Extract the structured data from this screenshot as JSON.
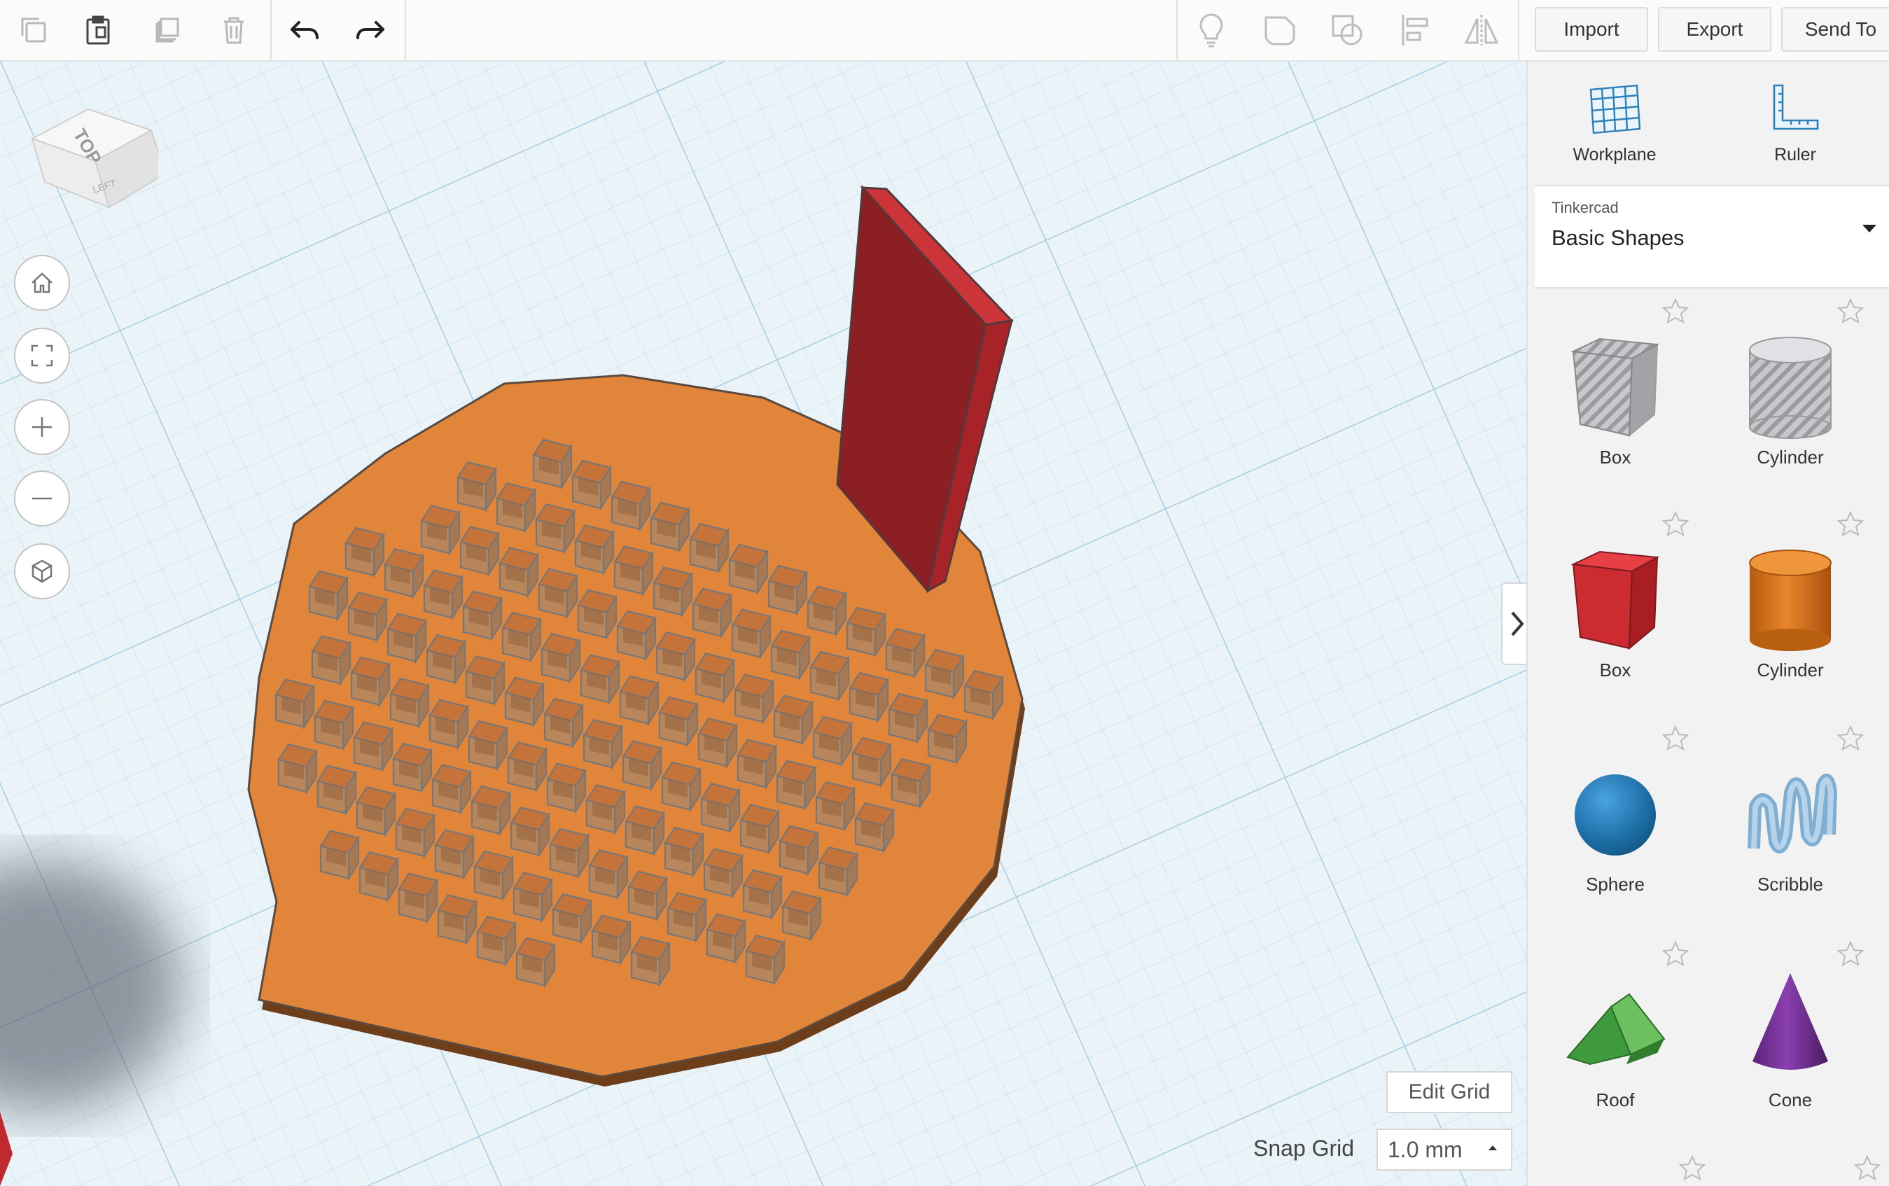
{
  "toolbar": {
    "import_label": "Import",
    "export_label": "Export",
    "send_label": "Send To"
  },
  "viewcube": {
    "top_label": "TOP",
    "left_label": "LEFT"
  },
  "sidebar": {
    "workplane_label": "Workplane",
    "ruler_label": "Ruler",
    "library": {
      "category": "Tinkercad",
      "name": "Basic Shapes"
    },
    "shapes": [
      {
        "label": "Box",
        "icon": "box-hole-icon"
      },
      {
        "label": "Cylinder",
        "icon": "cylinder-hole-icon"
      },
      {
        "label": "Box",
        "icon": "box-icon"
      },
      {
        "label": "Cylinder",
        "icon": "cylinder-icon"
      },
      {
        "label": "Sphere",
        "icon": "sphere-icon"
      },
      {
        "label": "Scribble",
        "icon": "scribble-icon"
      },
      {
        "label": "Roof",
        "icon": "roof-icon"
      },
      {
        "label": "Cone",
        "icon": "cone-icon"
      }
    ]
  },
  "grid": {
    "edit_label": "Edit Grid",
    "snap_label": "Snap Grid",
    "snap_value": "1.0 mm"
  },
  "colors": {
    "base_disk": "#e0853a",
    "red_wall": "#8c1f24",
    "workplane": "#e9f3f8",
    "grid_line": "#b9d8e6"
  }
}
